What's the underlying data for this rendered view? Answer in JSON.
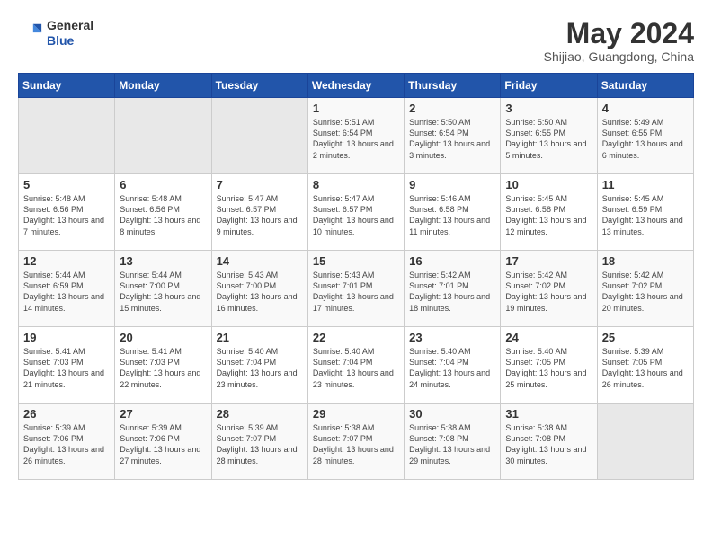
{
  "header": {
    "logo_line1": "General",
    "logo_line2": "Blue",
    "month_year": "May 2024",
    "location": "Shijiao, Guangdong, China"
  },
  "weekdays": [
    "Sunday",
    "Monday",
    "Tuesday",
    "Wednesday",
    "Thursday",
    "Friday",
    "Saturday"
  ],
  "weeks": [
    [
      {
        "day": "",
        "info": ""
      },
      {
        "day": "",
        "info": ""
      },
      {
        "day": "",
        "info": ""
      },
      {
        "day": "1",
        "info": "Sunrise: 5:51 AM\nSunset: 6:54 PM\nDaylight: 13 hours\nand 2 minutes."
      },
      {
        "day": "2",
        "info": "Sunrise: 5:50 AM\nSunset: 6:54 PM\nDaylight: 13 hours\nand 3 minutes."
      },
      {
        "day": "3",
        "info": "Sunrise: 5:50 AM\nSunset: 6:55 PM\nDaylight: 13 hours\nand 5 minutes."
      },
      {
        "day": "4",
        "info": "Sunrise: 5:49 AM\nSunset: 6:55 PM\nDaylight: 13 hours\nand 6 minutes."
      }
    ],
    [
      {
        "day": "5",
        "info": "Sunrise: 5:48 AM\nSunset: 6:56 PM\nDaylight: 13 hours\nand 7 minutes."
      },
      {
        "day": "6",
        "info": "Sunrise: 5:48 AM\nSunset: 6:56 PM\nDaylight: 13 hours\nand 8 minutes."
      },
      {
        "day": "7",
        "info": "Sunrise: 5:47 AM\nSunset: 6:57 PM\nDaylight: 13 hours\nand 9 minutes."
      },
      {
        "day": "8",
        "info": "Sunrise: 5:47 AM\nSunset: 6:57 PM\nDaylight: 13 hours\nand 10 minutes."
      },
      {
        "day": "9",
        "info": "Sunrise: 5:46 AM\nSunset: 6:58 PM\nDaylight: 13 hours\nand 11 minutes."
      },
      {
        "day": "10",
        "info": "Sunrise: 5:45 AM\nSunset: 6:58 PM\nDaylight: 13 hours\nand 12 minutes."
      },
      {
        "day": "11",
        "info": "Sunrise: 5:45 AM\nSunset: 6:59 PM\nDaylight: 13 hours\nand 13 minutes."
      }
    ],
    [
      {
        "day": "12",
        "info": "Sunrise: 5:44 AM\nSunset: 6:59 PM\nDaylight: 13 hours\nand 14 minutes."
      },
      {
        "day": "13",
        "info": "Sunrise: 5:44 AM\nSunset: 7:00 PM\nDaylight: 13 hours\nand 15 minutes."
      },
      {
        "day": "14",
        "info": "Sunrise: 5:43 AM\nSunset: 7:00 PM\nDaylight: 13 hours\nand 16 minutes."
      },
      {
        "day": "15",
        "info": "Sunrise: 5:43 AM\nSunset: 7:01 PM\nDaylight: 13 hours\nand 17 minutes."
      },
      {
        "day": "16",
        "info": "Sunrise: 5:42 AM\nSunset: 7:01 PM\nDaylight: 13 hours\nand 18 minutes."
      },
      {
        "day": "17",
        "info": "Sunrise: 5:42 AM\nSunset: 7:02 PM\nDaylight: 13 hours\nand 19 minutes."
      },
      {
        "day": "18",
        "info": "Sunrise: 5:42 AM\nSunset: 7:02 PM\nDaylight: 13 hours\nand 20 minutes."
      }
    ],
    [
      {
        "day": "19",
        "info": "Sunrise: 5:41 AM\nSunset: 7:03 PM\nDaylight: 13 hours\nand 21 minutes."
      },
      {
        "day": "20",
        "info": "Sunrise: 5:41 AM\nSunset: 7:03 PM\nDaylight: 13 hours\nand 22 minutes."
      },
      {
        "day": "21",
        "info": "Sunrise: 5:40 AM\nSunset: 7:04 PM\nDaylight: 13 hours\nand 23 minutes."
      },
      {
        "day": "22",
        "info": "Sunrise: 5:40 AM\nSunset: 7:04 PM\nDaylight: 13 hours\nand 23 minutes."
      },
      {
        "day": "23",
        "info": "Sunrise: 5:40 AM\nSunset: 7:04 PM\nDaylight: 13 hours\nand 24 minutes."
      },
      {
        "day": "24",
        "info": "Sunrise: 5:40 AM\nSunset: 7:05 PM\nDaylight: 13 hours\nand 25 minutes."
      },
      {
        "day": "25",
        "info": "Sunrise: 5:39 AM\nSunset: 7:05 PM\nDaylight: 13 hours\nand 26 minutes."
      }
    ],
    [
      {
        "day": "26",
        "info": "Sunrise: 5:39 AM\nSunset: 7:06 PM\nDaylight: 13 hours\nand 26 minutes."
      },
      {
        "day": "27",
        "info": "Sunrise: 5:39 AM\nSunset: 7:06 PM\nDaylight: 13 hours\nand 27 minutes."
      },
      {
        "day": "28",
        "info": "Sunrise: 5:39 AM\nSunset: 7:07 PM\nDaylight: 13 hours\nand 28 minutes."
      },
      {
        "day": "29",
        "info": "Sunrise: 5:38 AM\nSunset: 7:07 PM\nDaylight: 13 hours\nand 28 minutes."
      },
      {
        "day": "30",
        "info": "Sunrise: 5:38 AM\nSunset: 7:08 PM\nDaylight: 13 hours\nand 29 minutes."
      },
      {
        "day": "31",
        "info": "Sunrise: 5:38 AM\nSunset: 7:08 PM\nDaylight: 13 hours\nand 30 minutes."
      },
      {
        "day": "",
        "info": ""
      }
    ]
  ]
}
